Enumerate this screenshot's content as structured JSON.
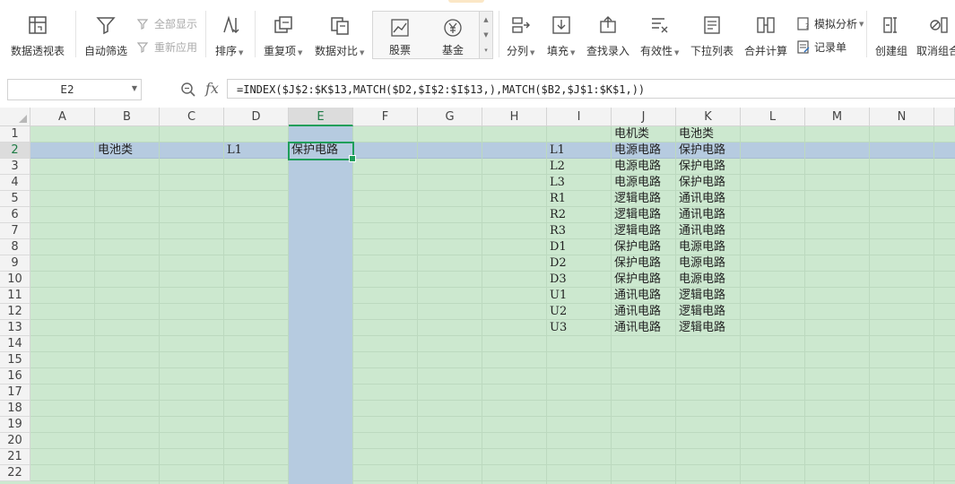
{
  "ribbon": {
    "pivot_label": "数据透视表",
    "autofilter_label": "自动筛选",
    "show_all_label": "全部显示",
    "reapply_label": "重新应用",
    "sort_label": "排序",
    "duplicates_label": "重复项",
    "compare_label": "数据对比",
    "stock_label": "股票",
    "fund_label": "基金",
    "split_label": "分列",
    "fill_label": "填充",
    "lookup_label": "查找录入",
    "validity_label": "有效性",
    "dropdown_list_label": "下拉列表",
    "consolidate_label": "合并计算",
    "whatif_label": "模拟分析",
    "record_form_label": "记录单",
    "group_label": "创建组",
    "ungroup_label": "取消组合"
  },
  "formula_bar": {
    "name_box": "E2",
    "fx_label": "fx",
    "formula": "=INDEX($J$2:$K$13,MATCH($D2,$I$2:$I$13,),MATCH($B2,$J$1:$K$1,))"
  },
  "sheet": {
    "columns": [
      "A",
      "B",
      "C",
      "D",
      "E",
      "F",
      "G",
      "H",
      "I",
      "J",
      "K",
      "L",
      "M",
      "N"
    ],
    "selected_column": "E",
    "selected_row": "2",
    "rows": [
      "1",
      "2",
      "3",
      "4",
      "5",
      "6",
      "7",
      "8",
      "9",
      "10",
      "11",
      "12",
      "13",
      "14",
      "15",
      "16",
      "17",
      "18",
      "19",
      "20",
      "21",
      "22"
    ],
    "header_row": {
      "J": "电机类",
      "K": "电池类"
    },
    "row2": {
      "B": "电池类",
      "D": "L1",
      "E": "保护电路"
    },
    "table": [
      {
        "I": "L1",
        "J": "电源电路",
        "K": "保护电路"
      },
      {
        "I": "L2",
        "J": "电源电路",
        "K": "保护电路"
      },
      {
        "I": "L3",
        "J": "电源电路",
        "K": "保护电路"
      },
      {
        "I": "R1",
        "J": "逻辑电路",
        "K": "通讯电路"
      },
      {
        "I": "R2",
        "J": "逻辑电路",
        "K": "通讯电路"
      },
      {
        "I": "R3",
        "J": "逻辑电路",
        "K": "通讯电路"
      },
      {
        "I": "D1",
        "J": "保护电路",
        "K": "电源电路"
      },
      {
        "I": "D2",
        "J": "保护电路",
        "K": "电源电路"
      },
      {
        "I": "D3",
        "J": "保护电路",
        "K": "电源电路"
      },
      {
        "I": "U1",
        "J": "通讯电路",
        "K": "逻辑电路"
      },
      {
        "I": "U2",
        "J": "通讯电路",
        "K": "逻辑电路"
      },
      {
        "I": "U3",
        "J": "通讯电路",
        "K": "逻辑电路"
      }
    ]
  },
  "colors": {
    "grid_background": "#cce8cf",
    "selection": "#b6cbe0",
    "active_border": "#1e9e5a"
  }
}
